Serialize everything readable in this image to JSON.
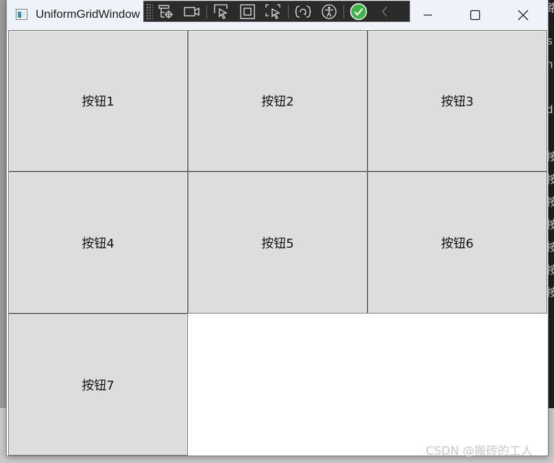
{
  "window": {
    "title": "UniformGridWindow"
  },
  "grid_buttons": [
    {
      "label": "按钮1"
    },
    {
      "label": "按钮2"
    },
    {
      "label": "按钮3"
    },
    {
      "label": "按钮4"
    },
    {
      "label": "按钮5"
    },
    {
      "label": "按钮6"
    },
    {
      "label": "按钮7"
    }
  ],
  "debug_toolbar": {
    "icons": [
      "live-visual-tree-icon",
      "record-icon",
      "select-element-icon",
      "display-layout-adorners-icon",
      "track-focus-icon",
      "hot-reload-icon",
      "accessibility-icon",
      "checkmark-status-icon",
      "collapse-chevron-icon"
    ],
    "status_color": "#3fb24a"
  },
  "background_editor": {
    "lines": [
      "路",
      "s",
      "n",
      "d",
      "按",
      "按",
      "按",
      "按",
      "按",
      "按",
      "按"
    ]
  },
  "watermark": {
    "text": "CSDN @搬砖的工人"
  },
  "colors": {
    "titlebar": "#eef3f9",
    "button_face": "#dddddd",
    "button_border": "#707070"
  }
}
